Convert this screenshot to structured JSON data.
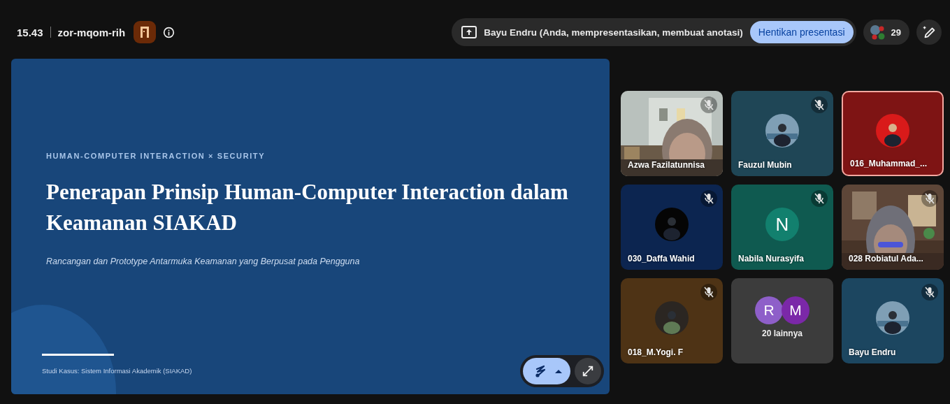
{
  "top_bar": {
    "time": "15.43",
    "meeting_code": "zor-mqom-rih"
  },
  "presenting": {
    "label": "Bayu Endru (Anda, mempresentasikan, membuat anotasi)",
    "stop_button": "Hentikan presentasi"
  },
  "participants": {
    "count": "29"
  },
  "slide": {
    "eyebrow": "HUMAN-COMPUTER INTERACTION × SECURITY",
    "title": "Penerapan Prinsip Human-Computer Interaction dalam Keamanan SIAKAD",
    "subtitle": "Rancangan dan Prototype Antarmuka Keamanan yang Berpusat pada Pengguna",
    "footer": "Studi Kasus: Sistem Informasi Akademik (SIAKAD)"
  },
  "tiles": [
    {
      "kind": "video",
      "name": "Azwa Fazilatunnisa",
      "muted": true,
      "active": false
    },
    {
      "kind": "avatar",
      "name": "Fauzul Mubin",
      "muted": true,
      "active": false,
      "color": "#1f4656"
    },
    {
      "kind": "avatar",
      "name": "016_Muhammad_...",
      "muted": false,
      "active": true,
      "color": "#7e1414"
    },
    {
      "kind": "avatar",
      "name": "030_Daffa Wahid",
      "muted": true,
      "active": false,
      "color": "#0c2550"
    },
    {
      "kind": "letter",
      "name": "Nabila Nurasyifa",
      "letter": "N",
      "muted": true,
      "active": false,
      "color": "#0f5a50"
    },
    {
      "kind": "video",
      "name": "028 Robiatul Ada...",
      "muted": true,
      "active": false
    },
    {
      "kind": "avatar",
      "name": "018_M.Yogi. F",
      "muted": true,
      "active": false,
      "color": "#4e3315"
    },
    {
      "kind": "group",
      "label": "20 lainnya",
      "letters": [
        {
          "letter": "R",
          "color": "#8e5fc9"
        },
        {
          "letter": "M",
          "color": "#7b28a8"
        }
      ]
    },
    {
      "kind": "avatar",
      "name": "Bayu Endru",
      "muted": true,
      "active": false,
      "color": "#1c4660"
    }
  ]
}
